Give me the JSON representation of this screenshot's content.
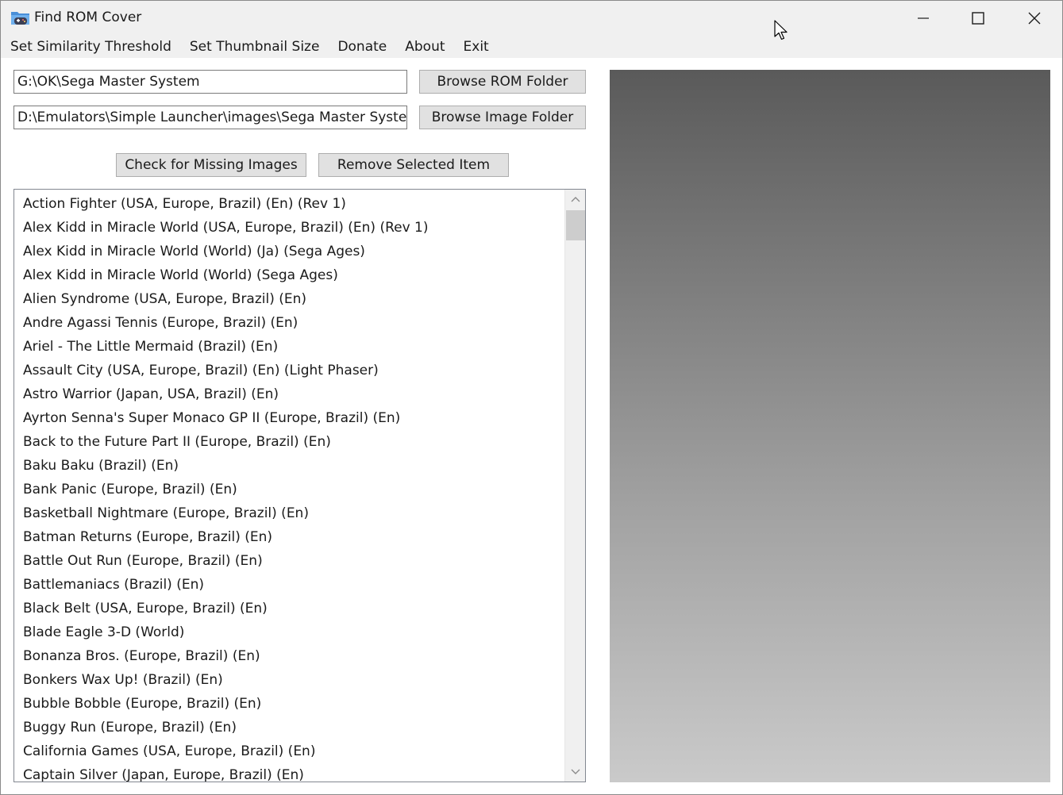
{
  "window": {
    "title": "Find ROM Cover"
  },
  "menu": [
    "Set Similarity Threshold",
    "Set Thumbnail Size",
    "Donate",
    "About",
    "Exit"
  ],
  "folders": {
    "rom_path": "G:\\OK\\Sega Master System",
    "image_path": "D:\\Emulators\\Simple Launcher\\images\\Sega Master System",
    "browse_rom_label": "Browse ROM Folder",
    "browse_image_label": "Browse Image Folder"
  },
  "actions": {
    "check_missing_label": "Check for Missing Images",
    "remove_selected_label": "Remove Selected Item"
  },
  "rom_list": [
    "Action Fighter (USA, Europe, Brazil) (En) (Rev 1)",
    "Alex Kidd in Miracle World (USA, Europe, Brazil) (En) (Rev 1)",
    "Alex Kidd in Miracle World (World) (Ja) (Sega Ages)",
    "Alex Kidd in Miracle World (World) (Sega Ages)",
    "Alien Syndrome (USA, Europe, Brazil) (En)",
    "Andre Agassi Tennis (Europe, Brazil) (En)",
    "Ariel - The Little Mermaid (Brazil) (En)",
    "Assault City (USA, Europe, Brazil) (En) (Light Phaser)",
    "Astro Warrior (Japan, USA, Brazil) (En)",
    "Ayrton Senna's Super Monaco GP II (Europe, Brazil) (En)",
    "Back to the Future Part II (Europe, Brazil) (En)",
    "Baku Baku (Brazil) (En)",
    "Bank Panic (Europe, Brazil) (En)",
    "Basketball Nightmare (Europe, Brazil) (En)",
    "Batman Returns (Europe, Brazil) (En)",
    "Battle Out Run (Europe, Brazil) (En)",
    "Battlemaniacs (Brazil) (En)",
    "Black Belt (USA, Europe, Brazil) (En)",
    "Blade Eagle 3-D (World)",
    "Bonanza Bros. (Europe, Brazil) (En)",
    "Bonkers Wax Up! (Brazil) (En)",
    "Bubble Bobble (Europe, Brazil) (En)",
    "Buggy Run (Europe, Brazil) (En)",
    "California Games (USA, Europe, Brazil) (En)",
    "Captain Silver (Japan, Europe, Brazil) (En)"
  ],
  "icons": {
    "app": "gamepad-folder-icon",
    "minimize": "minimize-icon",
    "maximize": "maximize-icon",
    "close": "close-icon",
    "scroll_up": "chevron-up-icon",
    "scroll_down": "chevron-down-icon",
    "cursor": "mouse-pointer-icon"
  }
}
